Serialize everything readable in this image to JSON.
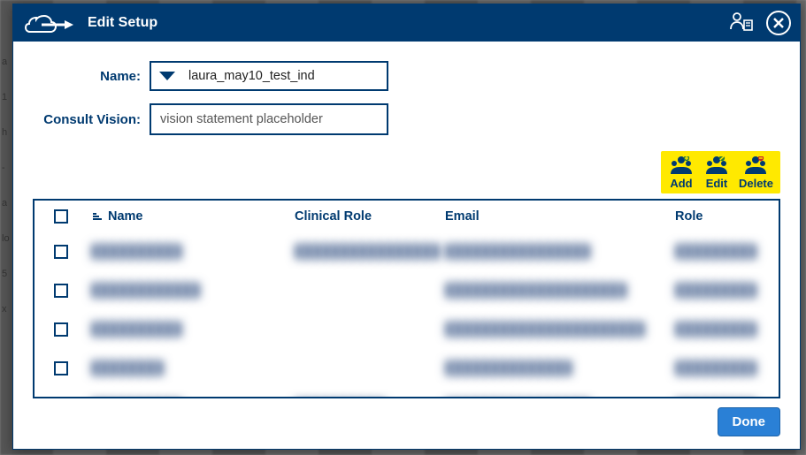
{
  "titlebar": {
    "title": "Edit Setup"
  },
  "form": {
    "name_label": "Name:",
    "name_value": "laura_may10_test_ind",
    "vision_label": "Consult Vision:",
    "vision_value": "vision statement placeholder"
  },
  "actions": {
    "add": "Add",
    "edit": "Edit",
    "delete": "Delete"
  },
  "table": {
    "headers": {
      "name": "Name",
      "clinical_role": "Clinical Role",
      "email": "Email",
      "role": "Role"
    },
    "rows": [
      {
        "name": "██████████",
        "clinical_role": "████████████████",
        "email": "████████████████",
        "role": "█████████"
      },
      {
        "name": "████████████",
        "clinical_role": "",
        "email": "████████████████████",
        "role": "█████████"
      },
      {
        "name": "██████████",
        "clinical_role": "",
        "email": "██████████████████████",
        "role": "█████████"
      },
      {
        "name": "████████",
        "clinical_role": "",
        "email": "██████████████",
        "role": "█████████"
      },
      {
        "name": "██████████",
        "clinical_role": "██████████",
        "email": "████████████████",
        "role": "█████████"
      }
    ]
  },
  "footer": {
    "done": "Done"
  },
  "colors": {
    "primary": "#003a70",
    "highlight": "#ffe900",
    "button": "#2a80d6"
  }
}
